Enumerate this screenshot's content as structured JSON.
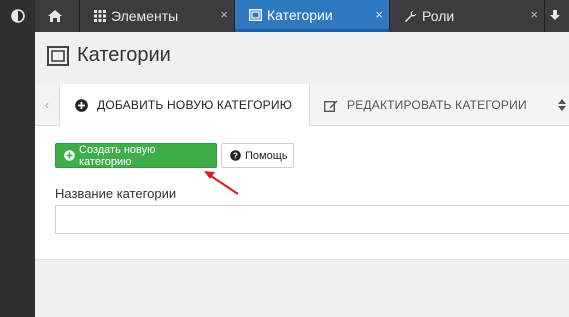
{
  "topbar": {
    "tabs": [
      {
        "label": "",
        "icon": "home-icon"
      },
      {
        "label": "Элементы",
        "icon": "grid-icon"
      },
      {
        "label": "Категории",
        "icon": "category-icon",
        "active": true
      },
      {
        "label": "Роли",
        "icon": "wrench-icon"
      }
    ],
    "close_glyph": "×"
  },
  "page": {
    "title": "Категории"
  },
  "subtabs": {
    "add_label": "ДОБАВИТЬ НОВУЮ КАТЕГОРИЮ",
    "edit_label": "РЕДАКТИРОВАТЬ КАТЕГОРИИ"
  },
  "toolbar": {
    "create_label": "Создать новую категорию",
    "help_label": "Помощь"
  },
  "form": {
    "name_label": "Название категории",
    "name_value": ""
  },
  "colors": {
    "accent": "#2f79c0",
    "create_button": "#3fae49",
    "annotation_arrow": "#d32020"
  }
}
